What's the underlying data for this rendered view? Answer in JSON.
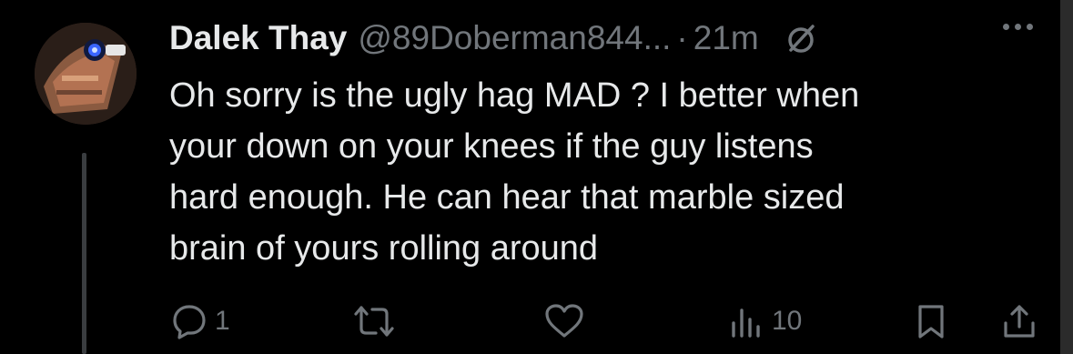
{
  "tweet": {
    "display_name": "Dalek Thay",
    "handle": "@89Doberman844...",
    "separator": "·",
    "time": "21m",
    "text": "Oh sorry is the ugly hag MAD ? I better when\nyour down on your knees if the guy listens\nhard enough. He can hear that marble sized\nbrain of yours rolling around"
  },
  "actions": {
    "reply_count": "1",
    "views_count": "10"
  },
  "icons": {
    "header": [
      "grok-icon",
      "more-icon"
    ],
    "actions": [
      "reply-icon",
      "retweet-icon",
      "like-icon",
      "views-icon",
      "bookmark-icon",
      "share-icon"
    ]
  },
  "colors": {
    "background": "#000000",
    "text": "#e7e9ea",
    "secondary": "#71767b",
    "thread_line": "#3a3d40"
  }
}
